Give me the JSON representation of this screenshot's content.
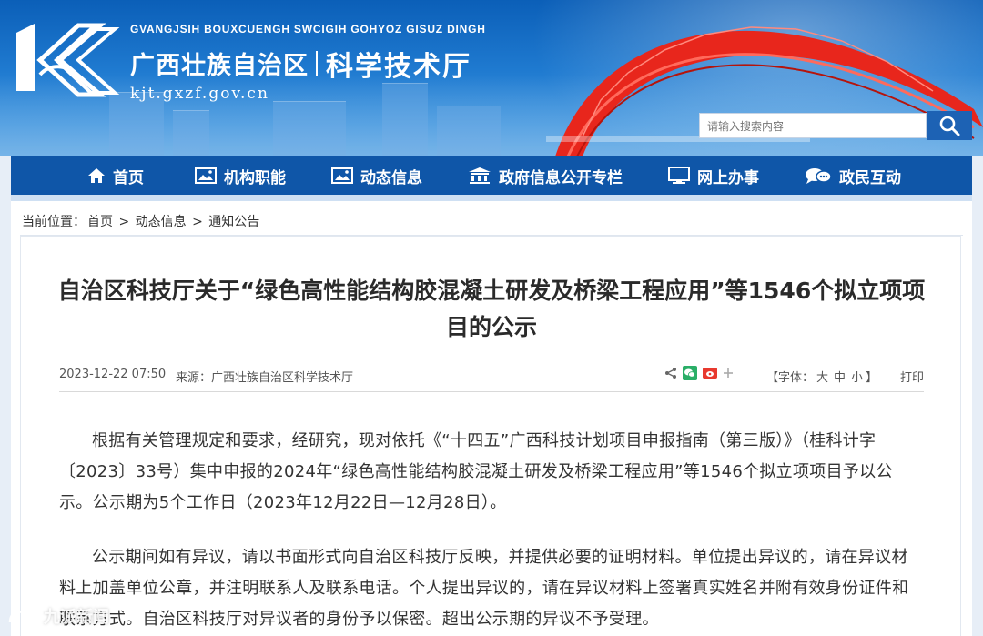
{
  "header": {
    "roman_name": "GVANGJSIH BOUXCUENGH SWCIGIH GOHYOZ GISUZ DINGH",
    "region_name": "广西壮族自治区",
    "dept_name": "科学技术厅",
    "url": "kjt.gxzf.gov.cn",
    "search_placeholder": "请输入搜索内容"
  },
  "nav": {
    "items": [
      {
        "label": "首页",
        "icon": "home-icon"
      },
      {
        "label": "机构职能",
        "icon": "image-icon"
      },
      {
        "label": "动态信息",
        "icon": "image-icon"
      },
      {
        "label": "政府信息公开专栏",
        "icon": "building-icon"
      },
      {
        "label": "网上办事",
        "icon": "monitor-icon"
      },
      {
        "label": "政民互动",
        "icon": "chat-icon"
      }
    ]
  },
  "breadcrumb": {
    "prefix": "当前位置：",
    "items": [
      "首页",
      "动态信息",
      "通知公告"
    ],
    "separator": ">"
  },
  "article": {
    "title": "自治区科技厅关于“绿色高性能结构胶混凝土研发及桥梁工程应用”等1546个拟立项项目的公示",
    "date": "2023-12-22 07:50",
    "source": "来源：广西壮族自治区科学技术厅",
    "font_label": "【字体：",
    "font_large": "大",
    "font_medium": "中",
    "font_small": "小",
    "font_close": "】",
    "print_label": "打印",
    "paragraphs": [
      "根据有关管理规定和要求，经研究，现对依托《“十四五”广西科技计划项目申报指南（第三版）》（桂科计字〔2023〕33号）集中申报的2024年“绿色高性能结构胶混凝土研发及桥梁工程应用”等1546个拟立项项目予以公示。公示期为5个工作日（2023年12月22日—12月28日）。",
      "公示期间如有异议，请以书面形式向自治区科技厅反映，并提供必要的证明材料。单位提出异议的，请在异议材料上加盖单位公章，并注明联系人及联系电话。个人提出异议的，请在异议材料上签署真实姓名并附有效身份证件和联系方式。自治区科技厅对异议者的身份予以保密。超出公示期的异议不予受理。"
    ]
  },
  "watermark": "九派新闻",
  "colors": {
    "nav_bg": "#0f56a8",
    "banner_top": "#0b5fb8",
    "bridge_red": "#e8261c",
    "search_button": "#1d62b4"
  }
}
